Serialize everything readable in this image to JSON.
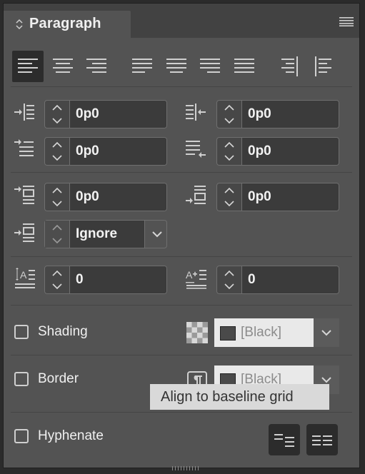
{
  "panel": {
    "title": "Paragraph"
  },
  "indents": {
    "left_indent": "0p0",
    "right_indent": "0p0",
    "first_line_indent": "0p0",
    "last_line_indent": "0p0"
  },
  "spacing": {
    "space_before": "0p0",
    "space_after": "0p0",
    "span_columns": "Ignore"
  },
  "drop_cap": {
    "lines": "0",
    "characters": "0"
  },
  "shading": {
    "label": "Shading",
    "color": "[Black]"
  },
  "border": {
    "label": "Border",
    "color": "[Black]"
  },
  "tooltip": {
    "text": "Align to baseline grid"
  },
  "hyphenate": {
    "label": "Hyphenate"
  },
  "colors": {
    "panel": "#535353",
    "field": "#3b3b3b",
    "selected": "#2c2c2c"
  }
}
